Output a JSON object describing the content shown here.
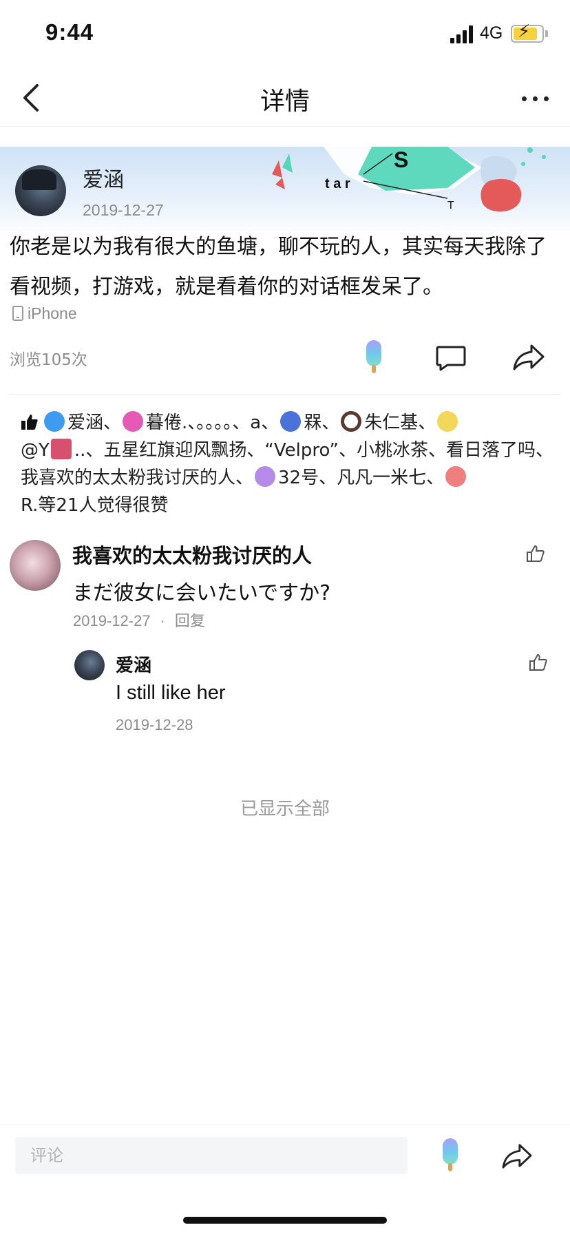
{
  "status_bar": {
    "time": "9:44",
    "network": "4G"
  },
  "nav": {
    "title": "详情"
  },
  "post": {
    "author": "爱涵",
    "date": "2019-12-27",
    "body": "你老是以为我有很大的鱼塘，聊不玩的人，其实每天我除了看视频，打游戏，就是看着你的对话框发呆了。",
    "device": "iPhone",
    "views": "浏览105次",
    "banner_text": {
      "s": "S",
      "tar": "t a r",
      "t": "T"
    }
  },
  "likes": {
    "users": [
      {
        "name": "爱涵、",
        "icon": "blue-bulb",
        "color": "#3f9bf0"
      },
      {
        "name": "暮倦.、。。。。、a、",
        "icon": "pink-flower",
        "color": "#e45ab5"
      },
      {
        "name": "槑、",
        "icon": "blue-fish",
        "color": "#4a72d8"
      },
      {
        "name": "朱仁基、",
        "icon": "donut",
        "color": "#5b3a2e"
      },
      {
        "name": "@Y",
        "icon": "yellow-cat",
        "color": "#f3d75a"
      },
      {
        "name": "..、五星红旗迎风飘扬、“Velpro”、小桃冰茶、看日落了吗、我喜欢的太太粉我讨厌的人、",
        "icon": "house",
        "color": "#d7506d"
      },
      {
        "name": "32号、凡凡一米七、",
        "icon": "purple-fish",
        "color": "#b58ae8"
      },
      {
        "name": "R.等21人觉得很赞",
        "icon": "red-heart",
        "color": "#ef7f7f"
      }
    ]
  },
  "comments": [
    {
      "name": "我喜欢的太太粉我讨厌的人",
      "text": "まだ彼女に会いたいですか?",
      "date": "2019-12-27",
      "reply_label": "回复",
      "separator": "·",
      "replies": [
        {
          "name": "爱涵",
          "text": "I still like her",
          "date": "2019-12-28"
        }
      ]
    }
  ],
  "footer": {
    "all_shown": "已显示全部",
    "comment_placeholder": "评论"
  },
  "colors": {
    "accent": "#58d4b8",
    "muted": "#8c8c8c",
    "banner_red": "#e45a5a"
  }
}
